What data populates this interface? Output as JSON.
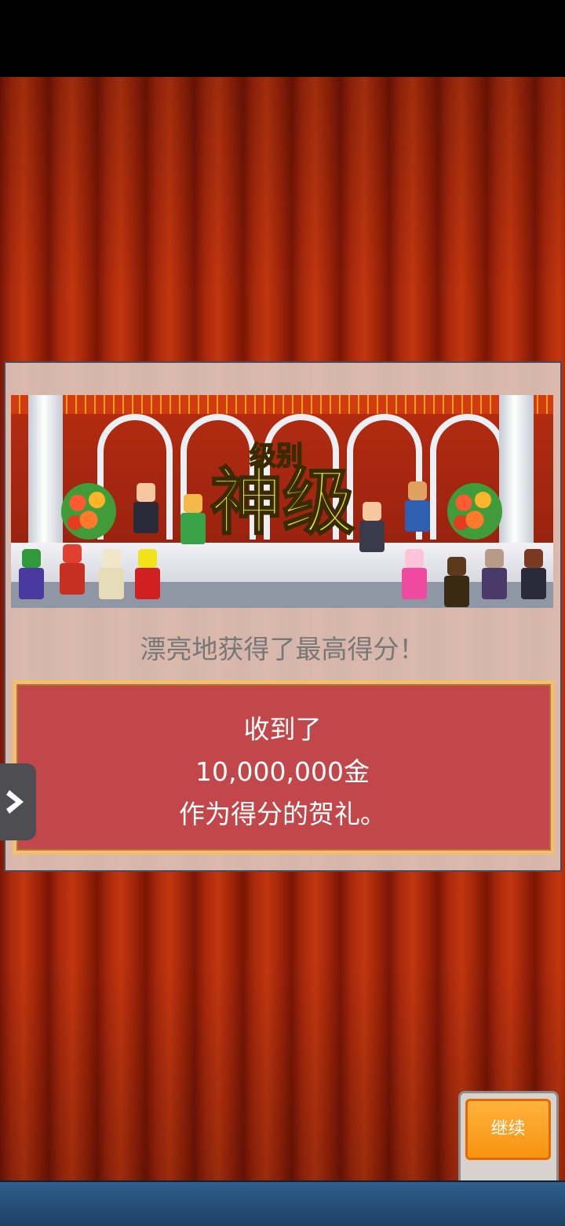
{
  "stage": {
    "rank_label": "级别",
    "rank_value": "神级"
  },
  "message": {
    "subtitle": "漂亮地获得了最高得分！",
    "reward_lines": [
      "收到了",
      "10,000,000金",
      "作为得分的贺礼。"
    ]
  },
  "buttons": {
    "continue_label": "继续"
  },
  "colors": {
    "rank_text": "#f5ef28",
    "reward_box": "#c2474b",
    "continue_button": "#f7930f"
  },
  "icons": {
    "side_tab": "chevron-right-icon"
  }
}
